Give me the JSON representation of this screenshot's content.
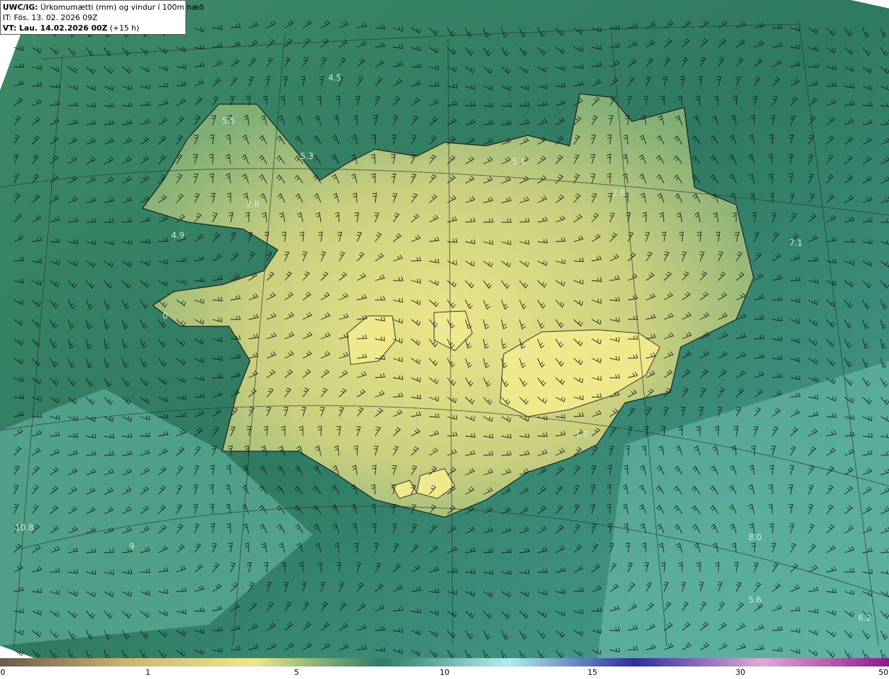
{
  "header": {
    "prefix": "UWC/IG:",
    "title": "Úrkomumætti (mm) og vindur í 100m hæð",
    "issue_time": "IT: Fös. 13. 02. 2026 09Z",
    "valid_prefix": "VT: Lau. 14.02.2026 00Z",
    "valid_suffix": "(+15 h)"
  },
  "map_labels": [
    {
      "text": "4.5"
    },
    {
      "text": "5.5"
    },
    {
      "text": "5.3"
    },
    {
      "text": "5.4"
    },
    {
      "text": "2.8"
    },
    {
      "text": "2.8"
    },
    {
      "text": "4.9"
    },
    {
      "text": "7.1"
    },
    {
      "text": "0"
    },
    {
      "text": "0"
    },
    {
      "text": "0.5"
    },
    {
      "text": "0.4"
    },
    {
      "text": "1.0"
    },
    {
      "text": "1.0"
    },
    {
      "text": "10.8"
    },
    {
      "text": "9"
    },
    {
      "text": "8.0"
    },
    {
      "text": "5.6"
    },
    {
      "text": "6.2"
    }
  ],
  "colorbar": {
    "ticks": [
      "0",
      "1",
      "5",
      "10",
      "15",
      "30",
      "50"
    ],
    "colors": [
      "#6b5a4a",
      "#c8b870",
      "#eae88a",
      "#2e7a66",
      "#aeeeee",
      "#2e2e9a",
      "#e0a8d8",
      "#8a1a8a"
    ]
  }
}
